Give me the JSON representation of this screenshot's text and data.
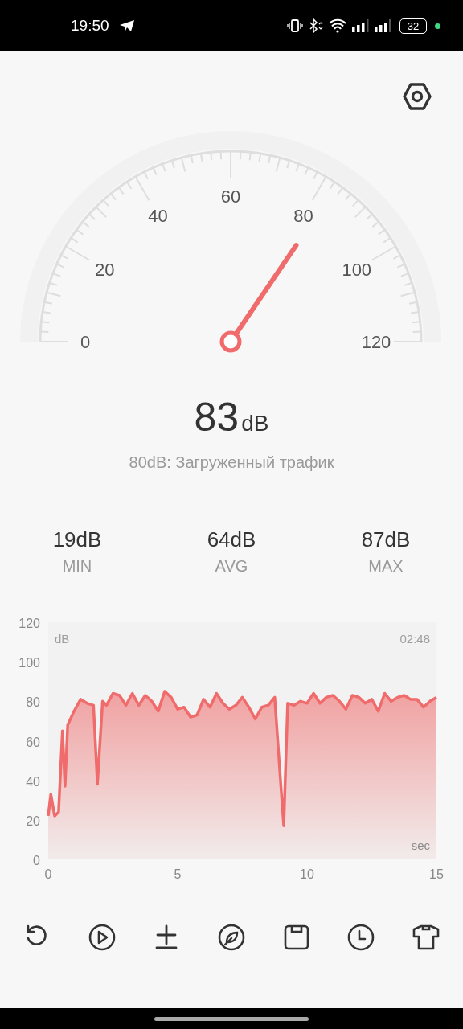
{
  "status_bar": {
    "time": "19:50",
    "battery": "32"
  },
  "gauge": {
    "labels": [
      "0",
      "20",
      "40",
      "60",
      "80",
      "100",
      "120"
    ]
  },
  "reading": {
    "value": "83",
    "unit": "dB",
    "description": "80dB: Загруженный трафик"
  },
  "stats": [
    {
      "value": "19dB",
      "label": "MIN"
    },
    {
      "value": "64dB",
      "label": "AVG"
    },
    {
      "value": "87dB",
      "label": "MAX"
    }
  ],
  "chart": {
    "unit_label": "dB",
    "time": "02:48",
    "x_unit_label": "sec",
    "chart_data": {
      "type": "area",
      "xlim": [
        0,
        15
      ],
      "ylim": [
        0,
        120
      ],
      "xticks": [
        0,
        5,
        10,
        15
      ],
      "yticks": [
        0,
        20,
        40,
        60,
        80,
        100,
        120
      ],
      "x": [
        0,
        0.1,
        0.25,
        0.4,
        0.55,
        0.65,
        0.75,
        1,
        1.25,
        1.5,
        1.75,
        1.9,
        2.1,
        2.25,
        2.5,
        2.75,
        3,
        3.25,
        3.5,
        3.75,
        4,
        4.25,
        4.5,
        4.75,
        5,
        5.25,
        5.5,
        5.75,
        6,
        6.25,
        6.5,
        6.75,
        7,
        7.25,
        7.5,
        7.75,
        8,
        8.25,
        8.5,
        8.75,
        9,
        9.1,
        9.25,
        9.5,
        9.75,
        10,
        10.25,
        10.5,
        10.75,
        11,
        11.25,
        11.5,
        11.75,
        12,
        12.25,
        12.5,
        12.75,
        13,
        13.25,
        13.5,
        13.75,
        14,
        14.25,
        14.5,
        14.75,
        15
      ],
      "series": [
        {
          "color": "#f06b6b",
          "values": [
            22,
            33,
            22,
            24,
            65,
            37,
            68,
            75,
            81,
            79,
            78,
            38,
            80,
            78,
            84,
            83,
            78,
            84,
            78,
            83,
            80,
            75,
            85,
            82,
            76,
            77,
            72,
            73,
            81,
            77,
            84,
            79,
            76,
            78,
            82,
            77,
            71,
            77,
            78,
            82,
            35,
            17,
            79,
            78,
            80,
            79,
            84,
            79,
            82,
            83,
            80,
            76,
            83,
            82,
            79,
            81,
            75,
            84,
            80,
            82,
            83,
            81,
            81,
            77,
            80,
            82
          ]
        }
      ]
    }
  },
  "nav": {
    "kind": "gesture"
  }
}
